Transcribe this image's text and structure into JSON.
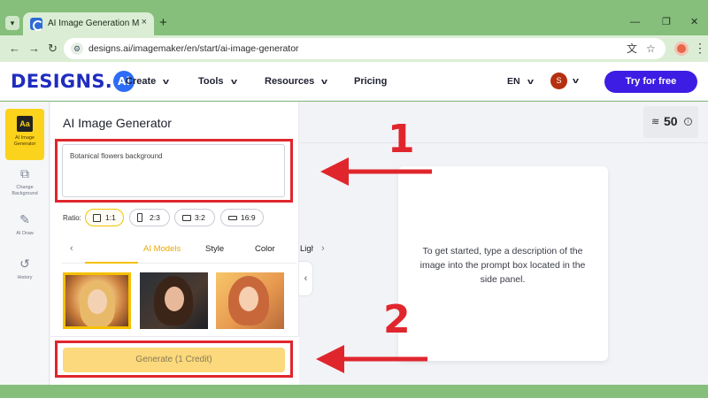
{
  "browser": {
    "tab_title": "AI Image Generation Made Eas",
    "tab_close": "×",
    "new_tab": "+",
    "url": "designs.ai/imagemaker/en/start/ai-image-generator",
    "back": "←",
    "forward": "→",
    "reload": "↻",
    "minimize": "—",
    "restore": "❐",
    "close": "✕",
    "tab_dropdown": "▾",
    "menu": "⋮"
  },
  "site": {
    "logo_text": "DESIGNS.",
    "logo_badge": "Ai",
    "nav": [
      "Create",
      "Tools",
      "Resources",
      "Pricing"
    ],
    "lang": "EN",
    "user_initial": "S",
    "cta": "Try for free"
  },
  "rail": {
    "items": [
      {
        "label": "AI Image Generator",
        "icon_glyph": "Aa",
        "icon": "ai-image-generator-icon"
      },
      {
        "label": "Change Background",
        "icon_glyph": "⧉",
        "icon": "change-background-icon"
      },
      {
        "label": "AI Draw",
        "icon_glyph": "✎",
        "icon": "brush-icon"
      },
      {
        "label": "History",
        "icon_glyph": "↺",
        "icon": "history-icon"
      }
    ]
  },
  "panel": {
    "title": "AI Image Generator",
    "prompt_value": "Botanical flowers background",
    "ratio_label": "Ratio:",
    "ratios": [
      "1:1",
      "2:3",
      "3:2",
      "16:9"
    ],
    "selected_ratio": "1:1",
    "tabs": [
      "AI Models",
      "Style",
      "Color",
      "Ligh"
    ],
    "active_tab": "AI Models",
    "tab_prev": "‹",
    "tab_next": "›",
    "generate_label": "Generate (1 Credit)",
    "collapse": "‹"
  },
  "canvas": {
    "credits": "50",
    "credits_info": "i",
    "credits_icon": "≋",
    "empty_message": "To get started, type a description of the image into the prompt box located in the side panel."
  },
  "annotations": {
    "step1": "1",
    "step2": "2"
  },
  "colors": {
    "accent_yellow": "#fbd21c",
    "brand_blue": "#3d1de3",
    "annotation_red": "#e0262d"
  }
}
